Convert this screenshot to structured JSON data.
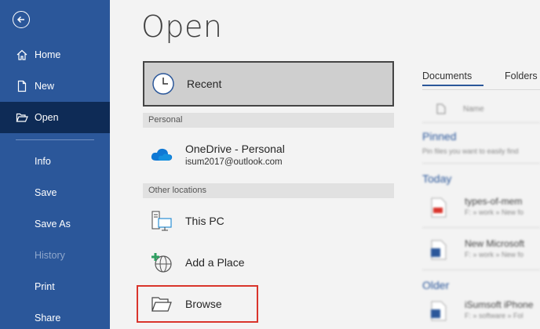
{
  "sidebar": {
    "items": [
      {
        "label": "Home"
      },
      {
        "label": "New"
      },
      {
        "label": "Open"
      },
      {
        "label": "Info"
      },
      {
        "label": "Save"
      },
      {
        "label": "Save As"
      },
      {
        "label": "History"
      },
      {
        "label": "Print"
      },
      {
        "label": "Share"
      }
    ]
  },
  "main": {
    "title": "Open",
    "recent_label": "Recent",
    "personal_header": "Personal",
    "onedrive_label": "OneDrive - Personal",
    "onedrive_email": "isum2017@outlook.com",
    "other_header": "Other locations",
    "this_pc_label": "This PC",
    "add_place_label": "Add a Place",
    "browse_label": "Browse"
  },
  "right_panel": {
    "tab_documents": "Documents",
    "tab_folders": "Folders",
    "column_name": "Name",
    "pinned_heading": "Pinned",
    "pinned_hint": "Pin files you want to easily find",
    "today_heading": "Today",
    "older_heading": "Older",
    "files": [
      {
        "name": "types-of-mem",
        "path": "F: » work » New fo"
      },
      {
        "name": "New Microsoft",
        "path": "F: » work » New fo"
      },
      {
        "name": "iSumsoft iPhone",
        "path": "F: » software » Fol"
      }
    ]
  },
  "colors": {
    "sidebar_bg": "#2b579a",
    "sidebar_active": "#0e2b56",
    "highlight_border": "#d9342b"
  }
}
